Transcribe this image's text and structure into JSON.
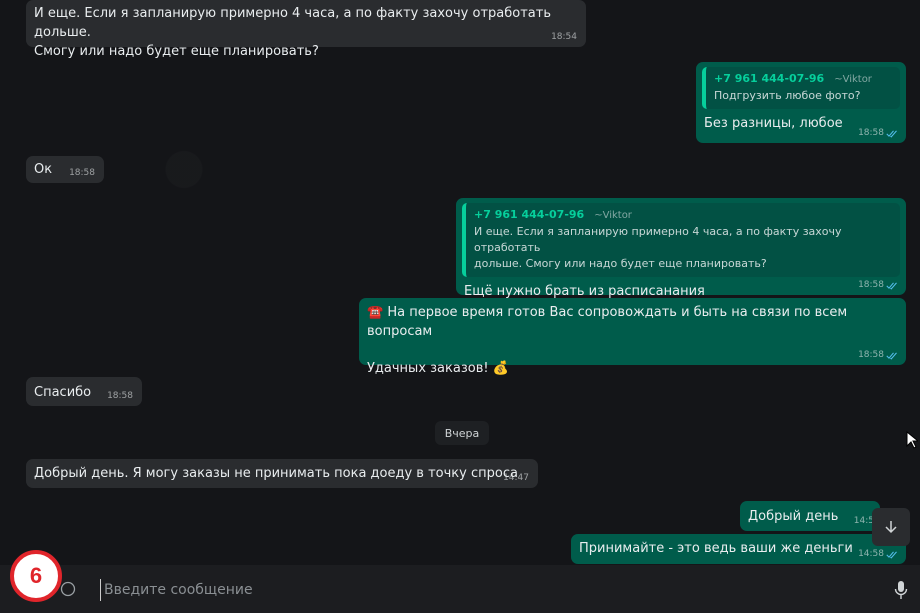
{
  "messages": {
    "m1": {
      "text_l1": "И еще. Если я запланирую примерно 4 часа, а по факту захочу отработать дольше.",
      "text_l2": "Смогу или надо будет еще планировать?",
      "time": "18:54"
    },
    "m2": {
      "quote_phone": "+7 961 444-07-96",
      "quote_name": "~Viktor",
      "quote_text": "Подгрузить любое фото?",
      "text": "Без разницы, любое",
      "time": "18:58"
    },
    "m3": {
      "text": "Ок",
      "time": "18:58"
    },
    "m4": {
      "quote_phone": "+7 961 444-07-96",
      "quote_name": "~Viktor",
      "quote_l1": "И еще. Если я запланирую примерно 4 часа, а по факту захочу отработать",
      "quote_l2": "дольше. Смогу или надо будет еще планировать?",
      "text": "Ещё нужно брать из расписанания",
      "time": "18:58"
    },
    "m5": {
      "text_l1": "☎️ На первое время готов Вас сопровождать и быть на связи по всем вопросам",
      "text_l2": "Удачных заказов! 💰",
      "time": "18:58"
    },
    "m6": {
      "text": "Спасибо",
      "time": "18:58"
    },
    "date_divider": "Вчера",
    "m7": {
      "text": "Добрый день. Я могу заказы не принимать пока доеду в точку спроса",
      "time": "14:47"
    },
    "m8": {
      "text": "Добрый день",
      "time": "14:5"
    },
    "m9": {
      "text": "Принимайте - это ведь ваши же деньги",
      "time": "14:58"
    }
  },
  "composer": {
    "placeholder": "Введите сообщение"
  },
  "badge": {
    "number": "6"
  },
  "icons": [
    "scroll-down-icon",
    "microphone-icon",
    "emoji-icon",
    "read-ticks-icon",
    "mouse-cursor-icon"
  ],
  "colors": {
    "incoming": "#2a2c2f",
    "outgoing": "#005c4b",
    "quote_accent": "#06cf9c",
    "badge": "#e0252b"
  }
}
